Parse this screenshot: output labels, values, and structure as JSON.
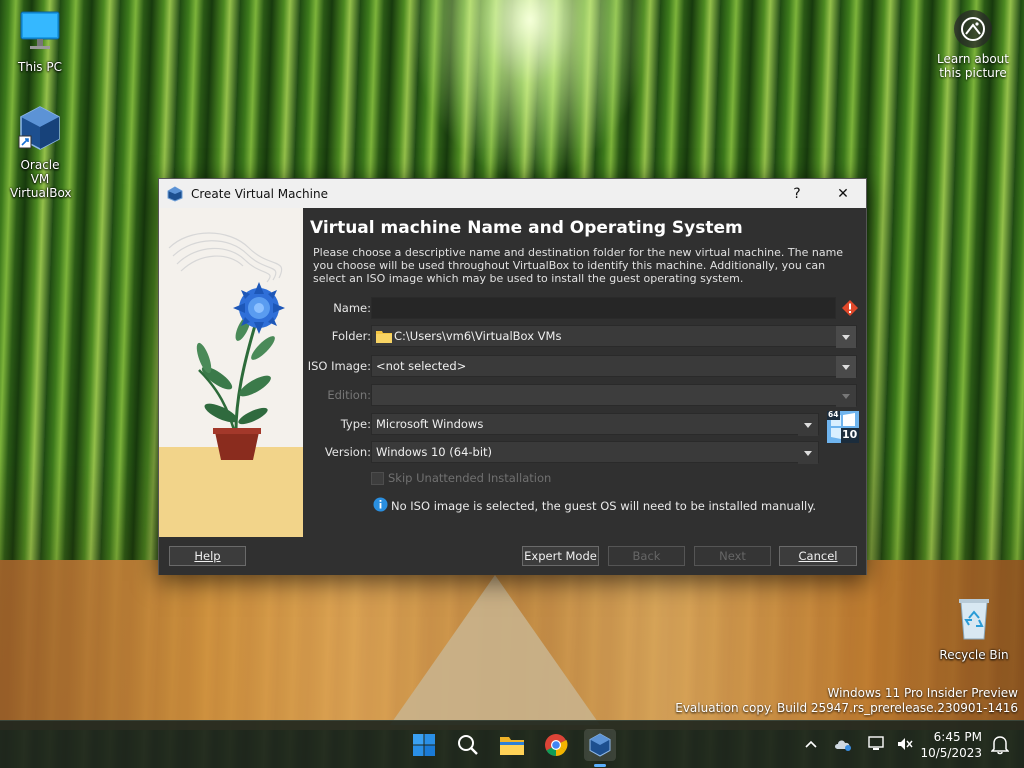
{
  "desktop": {
    "icons": [
      {
        "label": "This PC"
      },
      {
        "label": "Oracle VM VirtualBox"
      },
      {
        "label": "Recycle Bin"
      }
    ],
    "learn_label": "Learn about this picture",
    "watermark_line1": "Windows 11 Pro Insider Preview",
    "watermark_line2": "Evaluation copy. Build 25947.rs_prerelease.230901-1416"
  },
  "dialog": {
    "title": "Create Virtual Machine",
    "help_glyph": "?",
    "close_glyph": "✕",
    "heading": "Virtual machine Name and Operating System",
    "description": "Please choose a descriptive name and destination folder for the new virtual machine. The name you choose will be used throughout VirtualBox to identify this machine. Additionally, you can select an ISO image which may be used to install the guest operating system.",
    "fields": {
      "name_label": "Name:",
      "name_value": "",
      "folder_label": "Folder:",
      "folder_value": "C:\\Users\\vm6\\VirtualBox VMs",
      "iso_label": "ISO Image:",
      "iso_value": "<not selected>",
      "edition_label": "Edition:",
      "edition_value": "",
      "type_label": "Type:",
      "type_value": "Microsoft Windows",
      "version_label": "Version:",
      "version_value": "Windows 10 (64-bit)"
    },
    "os_badge_top": "64",
    "os_badge_bottom": "10",
    "skip_unattended_label": "Skip Unattended Installation",
    "info_message": "No ISO image is selected, the guest OS will need to be installed manually.",
    "buttons": {
      "help": "Help",
      "expert": "Expert Mode",
      "back": "Back",
      "next": "Next",
      "cancel": "Cancel"
    }
  },
  "taskbar": {
    "time": "6:45 PM",
    "date": "10/5/2023"
  },
  "colors": {
    "accent": "#0078d4",
    "dialog_bg": "#303030",
    "warning": "#e0482a"
  }
}
